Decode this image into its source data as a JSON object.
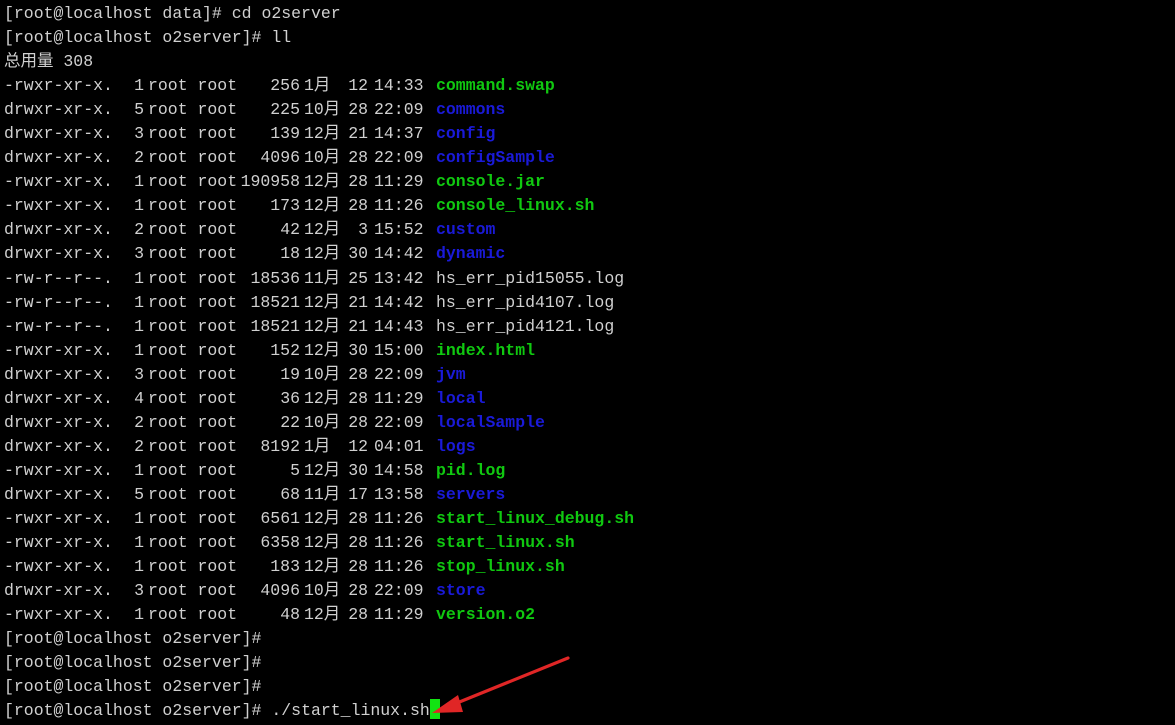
{
  "colors": {
    "text": "#d0d0d0",
    "executable": "#10c810",
    "directory": "#1a1ad8",
    "plain": "#d0d0d0",
    "cursor": "#12e312",
    "arrow": "#e02626"
  },
  "terminal": {
    "lines": [
      {
        "type": "command",
        "prompt": "[root@localhost data]#",
        "command": "cd o2server"
      },
      {
        "type": "command",
        "prompt": "[root@localhost o2server]#",
        "command": "ll"
      },
      {
        "type": "total",
        "text": "总用量 308"
      },
      {
        "type": "entry",
        "mode": "-rwxr-xr-x.",
        "links": "1",
        "owner": "root root",
        "size": "256",
        "month": "1月",
        "day": "12",
        "time": "14:33",
        "name": "command.swap",
        "kind": "executable"
      },
      {
        "type": "entry",
        "mode": "drwxr-xr-x.",
        "links": "5",
        "owner": "root root",
        "size": "225",
        "month": "10月",
        "day": "28",
        "time": "22:09",
        "name": "commons",
        "kind": "directory"
      },
      {
        "type": "entry",
        "mode": "drwxr-xr-x.",
        "links": "3",
        "owner": "root root",
        "size": "139",
        "month": "12月",
        "day": "21",
        "time": "14:37",
        "name": "config",
        "kind": "directory"
      },
      {
        "type": "entry",
        "mode": "drwxr-xr-x.",
        "links": "2",
        "owner": "root root",
        "size": "4096",
        "month": "10月",
        "day": "28",
        "time": "22:09",
        "name": "configSample",
        "kind": "directory"
      },
      {
        "type": "entry",
        "mode": "-rwxr-xr-x.",
        "links": "1",
        "owner": "root root",
        "size": "190958",
        "month": "12月",
        "day": "28",
        "time": "11:29",
        "name": "console.jar",
        "kind": "executable"
      },
      {
        "type": "entry",
        "mode": "-rwxr-xr-x.",
        "links": "1",
        "owner": "root root",
        "size": "173",
        "month": "12月",
        "day": "28",
        "time": "11:26",
        "name": "console_linux.sh",
        "kind": "executable"
      },
      {
        "type": "entry",
        "mode": "drwxr-xr-x.",
        "links": "2",
        "owner": "root root",
        "size": "42",
        "month": "12月",
        "day": "3",
        "time": "15:52",
        "name": "custom",
        "kind": "directory"
      },
      {
        "type": "entry",
        "mode": "drwxr-xr-x.",
        "links": "3",
        "owner": "root root",
        "size": "18",
        "month": "12月",
        "day": "30",
        "time": "14:42",
        "name": "dynamic",
        "kind": "directory"
      },
      {
        "type": "entry",
        "mode": "-rw-r--r--.",
        "links": "1",
        "owner": "root root",
        "size": "18536",
        "month": "11月",
        "day": "25",
        "time": "13:42",
        "name": "hs_err_pid15055.log",
        "kind": "plain"
      },
      {
        "type": "entry",
        "mode": "-rw-r--r--.",
        "links": "1",
        "owner": "root root",
        "size": "18521",
        "month": "12月",
        "day": "21",
        "time": "14:42",
        "name": "hs_err_pid4107.log",
        "kind": "plain"
      },
      {
        "type": "entry",
        "mode": "-rw-r--r--.",
        "links": "1",
        "owner": "root root",
        "size": "18521",
        "month": "12月",
        "day": "21",
        "time": "14:43",
        "name": "hs_err_pid4121.log",
        "kind": "plain"
      },
      {
        "type": "entry",
        "mode": "-rwxr-xr-x.",
        "links": "1",
        "owner": "root root",
        "size": "152",
        "month": "12月",
        "day": "30",
        "time": "15:00",
        "name": "index.html",
        "kind": "executable"
      },
      {
        "type": "entry",
        "mode": "drwxr-xr-x.",
        "links": "3",
        "owner": "root root",
        "size": "19",
        "month": "10月",
        "day": "28",
        "time": "22:09",
        "name": "jvm",
        "kind": "directory"
      },
      {
        "type": "entry",
        "mode": "drwxr-xr-x.",
        "links": "4",
        "owner": "root root",
        "size": "36",
        "month": "12月",
        "day": "28",
        "time": "11:29",
        "name": "local",
        "kind": "directory"
      },
      {
        "type": "entry",
        "mode": "drwxr-xr-x.",
        "links": "2",
        "owner": "root root",
        "size": "22",
        "month": "10月",
        "day": "28",
        "time": "22:09",
        "name": "localSample",
        "kind": "directory"
      },
      {
        "type": "entry",
        "mode": "drwxr-xr-x.",
        "links": "2",
        "owner": "root root",
        "size": "8192",
        "month": "1月",
        "day": "12",
        "time": "04:01",
        "name": "logs",
        "kind": "directory"
      },
      {
        "type": "entry",
        "mode": "-rwxr-xr-x.",
        "links": "1",
        "owner": "root root",
        "size": "5",
        "month": "12月",
        "day": "30",
        "time": "14:58",
        "name": "pid.log",
        "kind": "executable"
      },
      {
        "type": "entry",
        "mode": "drwxr-xr-x.",
        "links": "5",
        "owner": "root root",
        "size": "68",
        "month": "11月",
        "day": "17",
        "time": "13:58",
        "name": "servers",
        "kind": "directory"
      },
      {
        "type": "entry",
        "mode": "-rwxr-xr-x.",
        "links": "1",
        "owner": "root root",
        "size": "6561",
        "month": "12月",
        "day": "28",
        "time": "11:26",
        "name": "start_linux_debug.sh",
        "kind": "executable"
      },
      {
        "type": "entry",
        "mode": "-rwxr-xr-x.",
        "links": "1",
        "owner": "root root",
        "size": "6358",
        "month": "12月",
        "day": "28",
        "time": "11:26",
        "name": "start_linux.sh",
        "kind": "executable"
      },
      {
        "type": "entry",
        "mode": "-rwxr-xr-x.",
        "links": "1",
        "owner": "root root",
        "size": "183",
        "month": "12月",
        "day": "28",
        "time": "11:26",
        "name": "stop_linux.sh",
        "kind": "executable"
      },
      {
        "type": "entry",
        "mode": "drwxr-xr-x.",
        "links": "3",
        "owner": "root root",
        "size": "4096",
        "month": "10月",
        "day": "28",
        "time": "22:09",
        "name": "store",
        "kind": "directory"
      },
      {
        "type": "entry",
        "mode": "-rwxr-xr-x.",
        "links": "1",
        "owner": "root root",
        "size": "48",
        "month": "12月",
        "day": "28",
        "time": "11:29",
        "name": "version.o2",
        "kind": "executable"
      },
      {
        "type": "command",
        "prompt": "[root@localhost o2server]#",
        "command": ""
      },
      {
        "type": "command",
        "prompt": "[root@localhost o2server]#",
        "command": ""
      },
      {
        "type": "command",
        "prompt": "[root@localhost o2server]#",
        "command": ""
      },
      {
        "type": "command",
        "prompt": "[root@localhost o2server]#",
        "command": "./start_linux.sh",
        "cursor": true
      }
    ]
  },
  "annotation": {
    "icon": "red-arrow-icon",
    "points_to": "start_linux-command"
  }
}
